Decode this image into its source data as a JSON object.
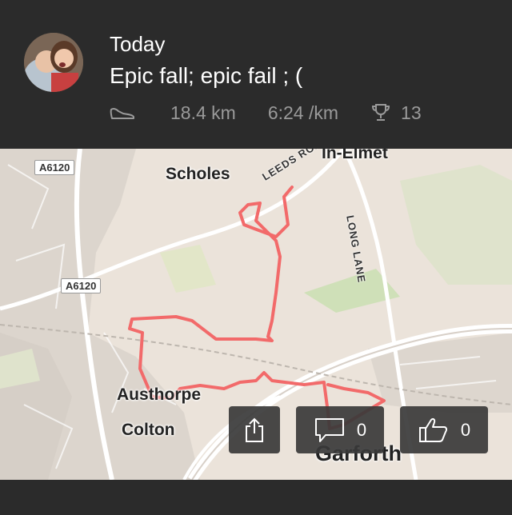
{
  "activity": {
    "date": "Today",
    "title": "Epic fall; epic fail ; (",
    "distance": "18.4 km",
    "pace": "6:24 /km",
    "achievements": "13"
  },
  "map": {
    "places": {
      "scholes": "Scholes",
      "austhorpe": "Austhorpe",
      "colton": "Colton",
      "garforth": "Garforth",
      "in_elmet": "In-Elmet"
    },
    "roads": {
      "a6120_top": "A6120",
      "a6120_mid": "A6120",
      "leeds_road": "LEEDS ROAD",
      "long_lane": "LONG LANE"
    },
    "route_color": "#f26a6a"
  },
  "actions": {
    "comments": "0",
    "kudos": "0"
  },
  "icons": {
    "sport": "shoe-icon",
    "achievements": "trophy-icon",
    "share": "share-icon",
    "comment": "comment-icon",
    "kudos": "thumbs-up-icon"
  }
}
